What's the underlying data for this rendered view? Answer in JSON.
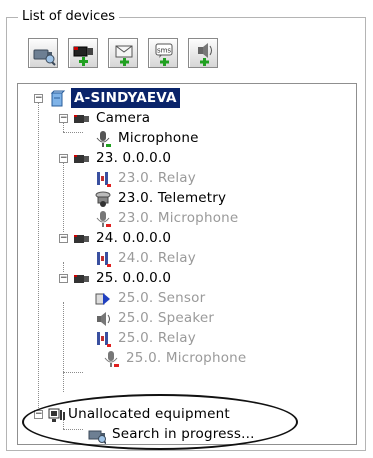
{
  "group_title": "List of devices",
  "toolbar": {
    "buttons": [
      {
        "name": "search-devices",
        "icon": "camera-search-icon"
      },
      {
        "name": "add-camera",
        "icon": "camera-add-icon"
      },
      {
        "name": "add-email",
        "icon": "envelope-add-icon"
      },
      {
        "name": "add-sms",
        "icon": "sms-add-icon"
      },
      {
        "name": "add-speaker",
        "icon": "speaker-add-icon"
      }
    ]
  },
  "tree": {
    "root": {
      "label": "A-SINDYAEVA",
      "selected": true
    },
    "camera": {
      "label": "Camera"
    },
    "camera_microphone": {
      "label": "Microphone"
    },
    "dev23": {
      "label": "23. 0.0.0.0"
    },
    "dev23_relay": {
      "label": "23.0. Relay"
    },
    "dev23_telemetry": {
      "label": "23.0. Telemetry"
    },
    "dev23_microphone": {
      "label": "23.0. Microphone"
    },
    "dev24": {
      "label": "24. 0.0.0.0"
    },
    "dev24_relay": {
      "label": "24.0. Relay"
    },
    "dev25": {
      "label": "25. 0.0.0.0"
    },
    "dev25_sensor": {
      "label": "25.0. Sensor"
    },
    "dev25_speaker": {
      "label": "25.0. Speaker"
    },
    "dev25_relay": {
      "label": "25.0. Relay"
    },
    "dev25_microphone": {
      "label": "25.0. Microphone"
    },
    "unallocated": {
      "label": "Unallocated equipment"
    },
    "search": {
      "label": "Search in progress..."
    }
  },
  "colors": {
    "selection": "#0a246a",
    "disabled_text": "#9a9a9a",
    "status_red": "#e02020",
    "status_green": "#20a020"
  }
}
